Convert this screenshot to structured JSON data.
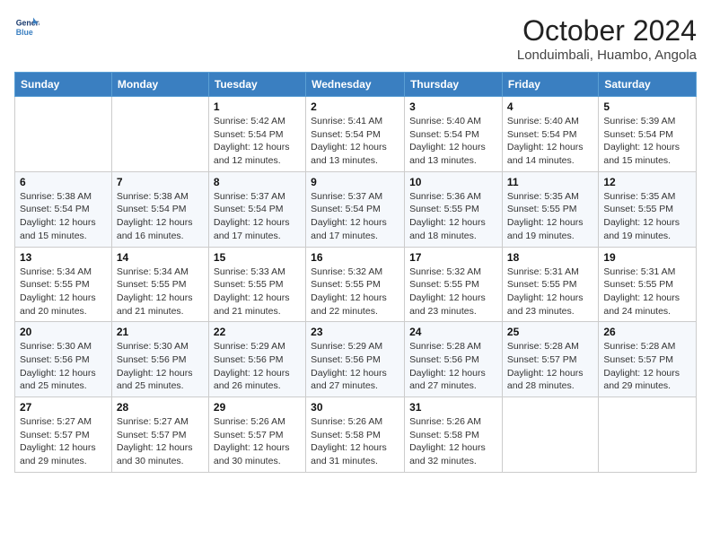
{
  "header": {
    "logo_line1": "General",
    "logo_line2": "Blue",
    "month": "October 2024",
    "location": "Londuimbali, Huambo, Angola"
  },
  "weekdays": [
    "Sunday",
    "Monday",
    "Tuesday",
    "Wednesday",
    "Thursday",
    "Friday",
    "Saturday"
  ],
  "weeks": [
    [
      {
        "day": "",
        "sunrise": "",
        "sunset": "",
        "daylight": ""
      },
      {
        "day": "",
        "sunrise": "",
        "sunset": "",
        "daylight": ""
      },
      {
        "day": "1",
        "sunrise": "Sunrise: 5:42 AM",
        "sunset": "Sunset: 5:54 PM",
        "daylight": "Daylight: 12 hours and 12 minutes."
      },
      {
        "day": "2",
        "sunrise": "Sunrise: 5:41 AM",
        "sunset": "Sunset: 5:54 PM",
        "daylight": "Daylight: 12 hours and 13 minutes."
      },
      {
        "day": "3",
        "sunrise": "Sunrise: 5:40 AM",
        "sunset": "Sunset: 5:54 PM",
        "daylight": "Daylight: 12 hours and 13 minutes."
      },
      {
        "day": "4",
        "sunrise": "Sunrise: 5:40 AM",
        "sunset": "Sunset: 5:54 PM",
        "daylight": "Daylight: 12 hours and 14 minutes."
      },
      {
        "day": "5",
        "sunrise": "Sunrise: 5:39 AM",
        "sunset": "Sunset: 5:54 PM",
        "daylight": "Daylight: 12 hours and 15 minutes."
      }
    ],
    [
      {
        "day": "6",
        "sunrise": "Sunrise: 5:38 AM",
        "sunset": "Sunset: 5:54 PM",
        "daylight": "Daylight: 12 hours and 15 minutes."
      },
      {
        "day": "7",
        "sunrise": "Sunrise: 5:38 AM",
        "sunset": "Sunset: 5:54 PM",
        "daylight": "Daylight: 12 hours and 16 minutes."
      },
      {
        "day": "8",
        "sunrise": "Sunrise: 5:37 AM",
        "sunset": "Sunset: 5:54 PM",
        "daylight": "Daylight: 12 hours and 17 minutes."
      },
      {
        "day": "9",
        "sunrise": "Sunrise: 5:37 AM",
        "sunset": "Sunset: 5:54 PM",
        "daylight": "Daylight: 12 hours and 17 minutes."
      },
      {
        "day": "10",
        "sunrise": "Sunrise: 5:36 AM",
        "sunset": "Sunset: 5:55 PM",
        "daylight": "Daylight: 12 hours and 18 minutes."
      },
      {
        "day": "11",
        "sunrise": "Sunrise: 5:35 AM",
        "sunset": "Sunset: 5:55 PM",
        "daylight": "Daylight: 12 hours and 19 minutes."
      },
      {
        "day": "12",
        "sunrise": "Sunrise: 5:35 AM",
        "sunset": "Sunset: 5:55 PM",
        "daylight": "Daylight: 12 hours and 19 minutes."
      }
    ],
    [
      {
        "day": "13",
        "sunrise": "Sunrise: 5:34 AM",
        "sunset": "Sunset: 5:55 PM",
        "daylight": "Daylight: 12 hours and 20 minutes."
      },
      {
        "day": "14",
        "sunrise": "Sunrise: 5:34 AM",
        "sunset": "Sunset: 5:55 PM",
        "daylight": "Daylight: 12 hours and 21 minutes."
      },
      {
        "day": "15",
        "sunrise": "Sunrise: 5:33 AM",
        "sunset": "Sunset: 5:55 PM",
        "daylight": "Daylight: 12 hours and 21 minutes."
      },
      {
        "day": "16",
        "sunrise": "Sunrise: 5:32 AM",
        "sunset": "Sunset: 5:55 PM",
        "daylight": "Daylight: 12 hours and 22 minutes."
      },
      {
        "day": "17",
        "sunrise": "Sunrise: 5:32 AM",
        "sunset": "Sunset: 5:55 PM",
        "daylight": "Daylight: 12 hours and 23 minutes."
      },
      {
        "day": "18",
        "sunrise": "Sunrise: 5:31 AM",
        "sunset": "Sunset: 5:55 PM",
        "daylight": "Daylight: 12 hours and 23 minutes."
      },
      {
        "day": "19",
        "sunrise": "Sunrise: 5:31 AM",
        "sunset": "Sunset: 5:55 PM",
        "daylight": "Daylight: 12 hours and 24 minutes."
      }
    ],
    [
      {
        "day": "20",
        "sunrise": "Sunrise: 5:30 AM",
        "sunset": "Sunset: 5:56 PM",
        "daylight": "Daylight: 12 hours and 25 minutes."
      },
      {
        "day": "21",
        "sunrise": "Sunrise: 5:30 AM",
        "sunset": "Sunset: 5:56 PM",
        "daylight": "Daylight: 12 hours and 25 minutes."
      },
      {
        "day": "22",
        "sunrise": "Sunrise: 5:29 AM",
        "sunset": "Sunset: 5:56 PM",
        "daylight": "Daylight: 12 hours and 26 minutes."
      },
      {
        "day": "23",
        "sunrise": "Sunrise: 5:29 AM",
        "sunset": "Sunset: 5:56 PM",
        "daylight": "Daylight: 12 hours and 27 minutes."
      },
      {
        "day": "24",
        "sunrise": "Sunrise: 5:28 AM",
        "sunset": "Sunset: 5:56 PM",
        "daylight": "Daylight: 12 hours and 27 minutes."
      },
      {
        "day": "25",
        "sunrise": "Sunrise: 5:28 AM",
        "sunset": "Sunset: 5:57 PM",
        "daylight": "Daylight: 12 hours and 28 minutes."
      },
      {
        "day": "26",
        "sunrise": "Sunrise: 5:28 AM",
        "sunset": "Sunset: 5:57 PM",
        "daylight": "Daylight: 12 hours and 29 minutes."
      }
    ],
    [
      {
        "day": "27",
        "sunrise": "Sunrise: 5:27 AM",
        "sunset": "Sunset: 5:57 PM",
        "daylight": "Daylight: 12 hours and 29 minutes."
      },
      {
        "day": "28",
        "sunrise": "Sunrise: 5:27 AM",
        "sunset": "Sunset: 5:57 PM",
        "daylight": "Daylight: 12 hours and 30 minutes."
      },
      {
        "day": "29",
        "sunrise": "Sunrise: 5:26 AM",
        "sunset": "Sunset: 5:57 PM",
        "daylight": "Daylight: 12 hours and 30 minutes."
      },
      {
        "day": "30",
        "sunrise": "Sunrise: 5:26 AM",
        "sunset": "Sunset: 5:58 PM",
        "daylight": "Daylight: 12 hours and 31 minutes."
      },
      {
        "day": "31",
        "sunrise": "Sunrise: 5:26 AM",
        "sunset": "Sunset: 5:58 PM",
        "daylight": "Daylight: 12 hours and 32 minutes."
      },
      {
        "day": "",
        "sunrise": "",
        "sunset": "",
        "daylight": ""
      },
      {
        "day": "",
        "sunrise": "",
        "sunset": "",
        "daylight": ""
      }
    ]
  ]
}
